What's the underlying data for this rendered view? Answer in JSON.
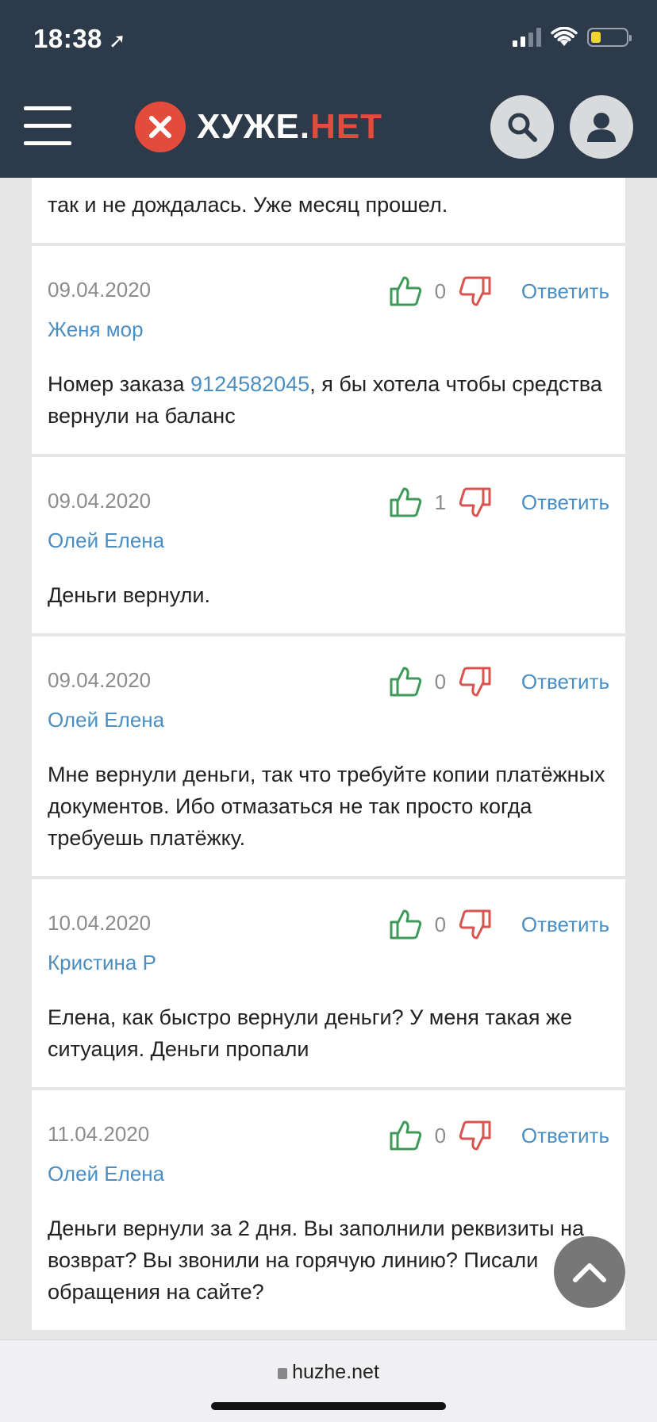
{
  "status_bar": {
    "time": "18:38"
  },
  "header": {
    "logo_main": "ХУЖЕ.",
    "logo_accent": "НЕТ"
  },
  "top_partial_comment": {
    "text": "так и не дождалась. Уже месяц прошел."
  },
  "comments": [
    {
      "date": "09.04.2020",
      "author": "Женя мор",
      "votes": "0",
      "reply": "Ответить",
      "text_before": "Номер заказа ",
      "link": "9124582045",
      "text_after": ", я бы хотела чтобы средства вернули на баланс"
    },
    {
      "date": "09.04.2020",
      "author": "Олей Елена",
      "votes": "1",
      "reply": "Ответить",
      "text": "Деньги вернули."
    },
    {
      "date": "09.04.2020",
      "author": "Олей Елена",
      "votes": "0",
      "reply": "Ответить",
      "text": "Мне вернули деньги, так что требуйте копии платёжных документов. Ибо отмазаться не так просто когда требуешь платёжку."
    },
    {
      "date": "10.04.2020",
      "author": "Кристина Р",
      "votes": "0",
      "reply": "Ответить",
      "text": "Елена, как быстро вернули деньги? У меня такая же ситуация. Деньги пропали"
    },
    {
      "date": "11.04.2020",
      "author": "Олей Елена",
      "votes": "0",
      "reply": "Ответить",
      "text": "Деньги вернули за 2 дня. Вы заполнили реквизиты на возврат? Вы звонили на горячую линию? Писали обращения на сайте?"
    }
  ],
  "browser": {
    "url": "huzhe.net"
  },
  "colors": {
    "header_bg": "#2c3a4a",
    "brand_red": "#e34b3c",
    "link_blue": "#4a8ec2",
    "like_green": "#3f9a5a",
    "dislike_red": "#d9534f"
  }
}
